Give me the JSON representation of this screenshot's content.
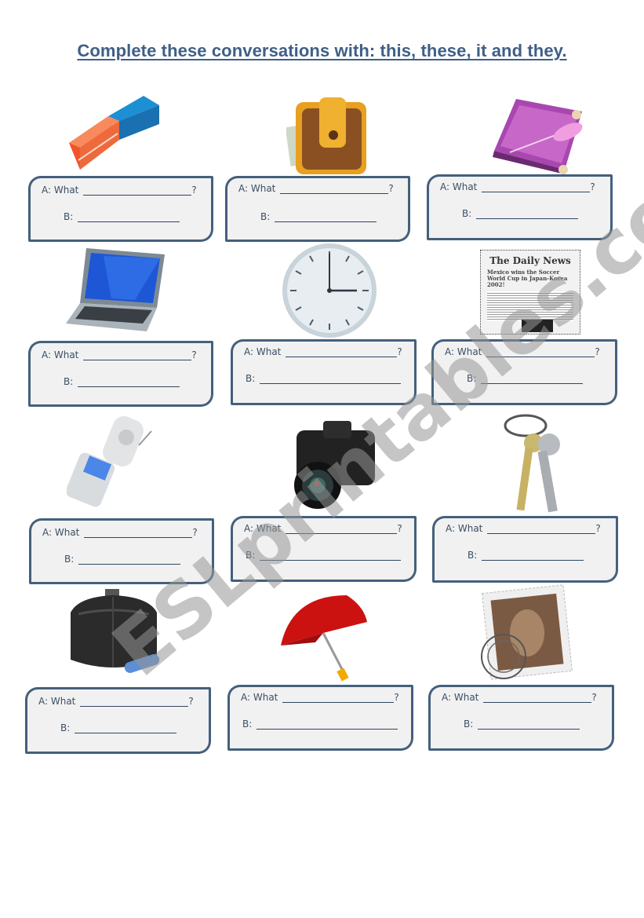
{
  "title": "Complete these conversations with: this, these, it and they.",
  "watermark": "ESLprintables.com",
  "prompt_a": "A: What",
  "question_mark": "?",
  "prompt_b": "B:",
  "items": [
    {
      "picture": "eraser"
    },
    {
      "picture": "wallet"
    },
    {
      "picture": "book"
    },
    {
      "picture": "laptop"
    },
    {
      "picture": "clock"
    },
    {
      "picture": "newspaper",
      "headline": "The Daily News",
      "subhead": "Mexico wins the Soccer World Cup in Japan-Korea 2002!"
    },
    {
      "picture": "mobile-phone"
    },
    {
      "picture": "camera"
    },
    {
      "picture": "keys"
    },
    {
      "picture": "handbag"
    },
    {
      "picture": "umbrella"
    },
    {
      "picture": "stamp"
    }
  ],
  "answers": {
    "a": [
      "",
      "",
      "",
      "",
      "",
      "",
      "",
      "",
      "",
      "",
      "",
      ""
    ],
    "b": [
      "",
      "",
      "",
      "",
      "",
      "",
      "",
      "",
      "",
      "",
      "",
      ""
    ]
  }
}
